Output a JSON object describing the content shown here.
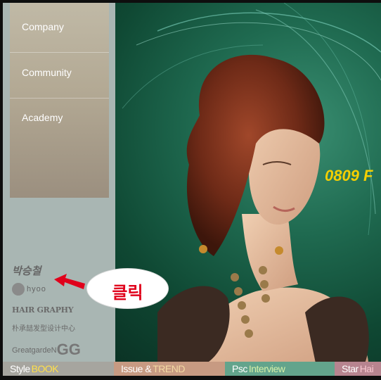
{
  "sidebar": {
    "menu": [
      {
        "label": "Company"
      },
      {
        "label": "Community"
      },
      {
        "label": "Academy"
      }
    ],
    "logos": {
      "signature": "박승철",
      "hyoo": "hyoo",
      "hairgraphy": "HAIR GRAPHY",
      "chinese": "朴承喆发型设计中心",
      "greatgarden": "GreatgardeN",
      "gg": "GG"
    }
  },
  "main": {
    "headline": "0809 F"
  },
  "callout": {
    "text": "클릭",
    "color": "#e0001b"
  },
  "tabs": [
    {
      "part1": "Style",
      "part2": "BOOK",
      "bg": "#a6a59f",
      "accent": "#ffe04a"
    },
    {
      "part1": "Issue &",
      "part2": "TREND",
      "bg": "#c79a82",
      "accent": "#f3d9a3"
    },
    {
      "part1": "Psc",
      "part2": "Interview",
      "bg": "#63a48c",
      "accent": "#d6f0a8"
    },
    {
      "part1": "Star",
      "part2": "Hai",
      "bg": "#b7848f",
      "accent": "#f7c7cf"
    }
  ]
}
